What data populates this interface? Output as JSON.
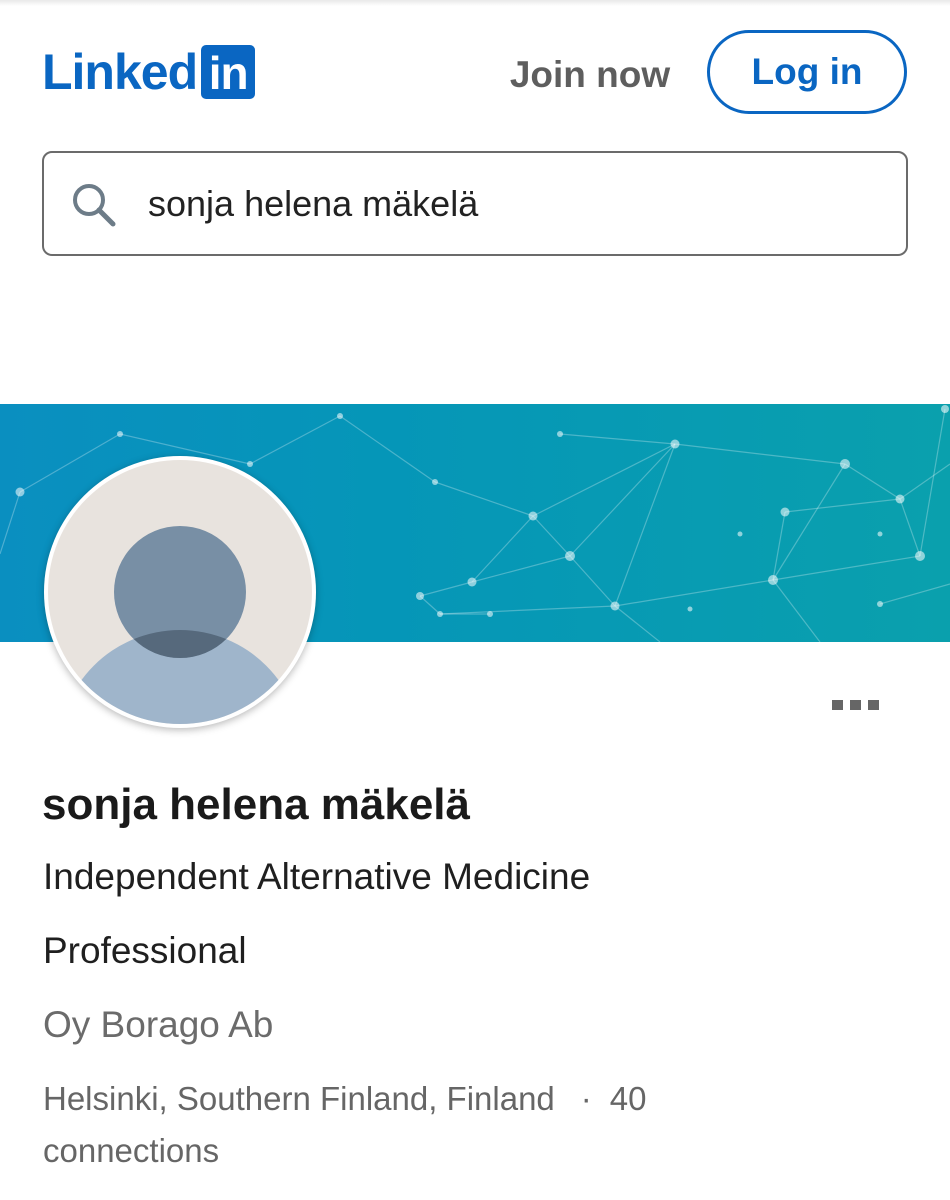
{
  "header": {
    "logo_text": "Linked",
    "logo_box_text": "in",
    "join_now_label": "Join now",
    "login_label": "Log in",
    "brand_color": "#0a66c2"
  },
  "search": {
    "value": "sonja helena mäkelä",
    "icon": "search-icon"
  },
  "profile": {
    "name": "sonja helena mäkelä",
    "headline": "Independent Alternative Medicine Professional",
    "company": "Oy Borago Ab",
    "location": "Helsinki, Southern Finland, Finland",
    "separator": "·",
    "connections": "40 connections",
    "avatar_icon": "default-person-avatar",
    "more_icon": "more-options-icon"
  }
}
